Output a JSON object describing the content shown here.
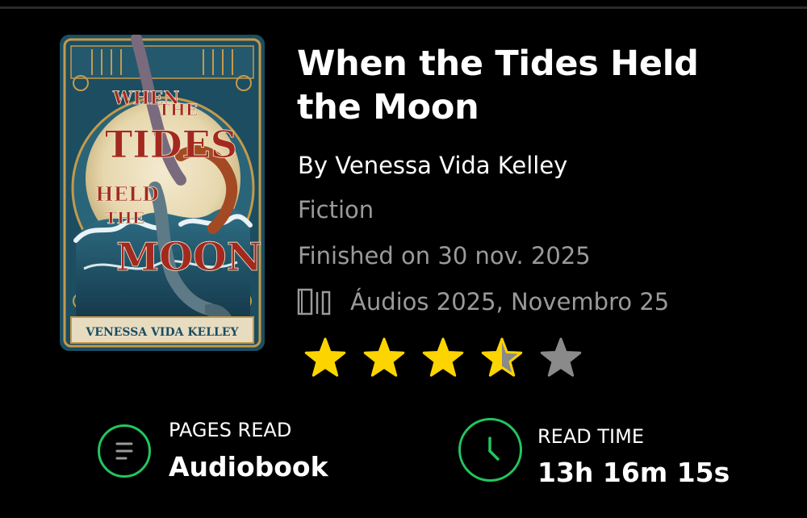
{
  "book": {
    "title": "When the Tides Held the Moon",
    "author": "By Venessa Vida Kelley",
    "genre": "Fiction",
    "finished": "Finished on 30 nov. 2025",
    "shelf": "Áudios 2025, Novembro 25",
    "rating": 3.5,
    "rating_max": 5,
    "cover": {
      "title_line1": "WHEN",
      "title_line2": "THE",
      "title_line3": "TIDES",
      "title_line4": "HELD",
      "title_line5": "THE",
      "title_line6": "MOON",
      "author_band": "VENESSA VIDA KELLEY"
    }
  },
  "stats": {
    "pages": {
      "label": "PAGES READ",
      "value": "Audiobook",
      "icon": "list-icon"
    },
    "time": {
      "label": "READ TIME",
      "value": "13h 16m 15s",
      "icon": "clock-icon"
    }
  },
  "colors": {
    "background": "#000000",
    "accent": "#22c55e",
    "star_filled": "#fcd400",
    "star_empty": "#8a8a8a",
    "muted_text": "#9a9a9a"
  }
}
